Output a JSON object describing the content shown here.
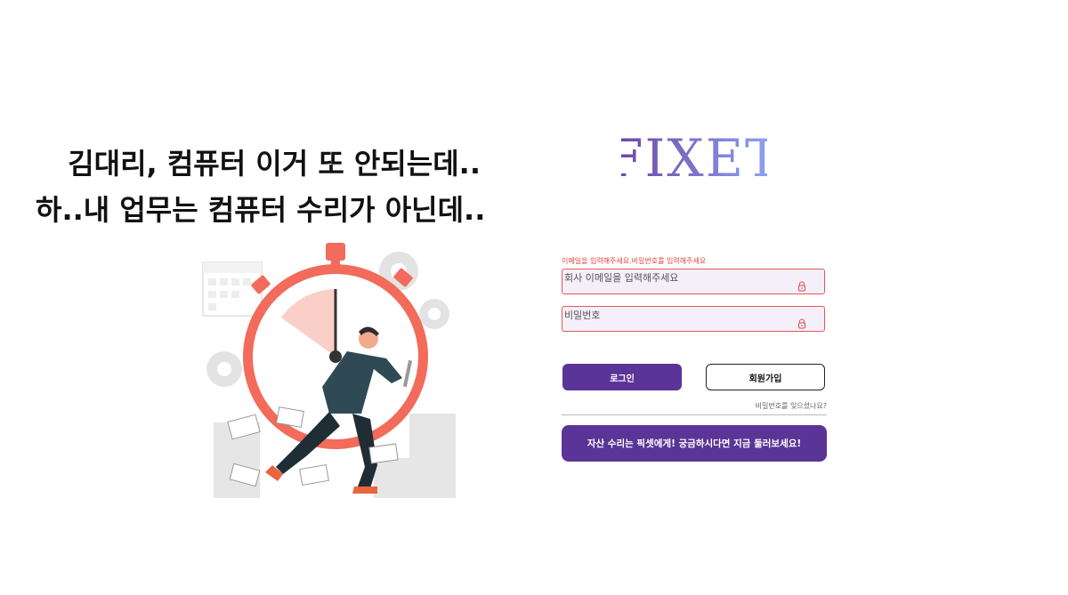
{
  "headline": {
    "line1": "김대리, 컴퓨터 이거 또 안되는데..",
    "line2": "하..내 업무는 컴퓨터 수리가 아닌데.."
  },
  "logo": {
    "text": "FIXET",
    "gradient_start": "#6b3fa0",
    "gradient_end": "#8fa8f5"
  },
  "login": {
    "error_message": "이메일을 입력해주세요.비밀번호를 입력해주세요",
    "email_placeholder": "회사 이메일을 입력해주세요",
    "password_placeholder": "비밀번호",
    "login_label": "로그인",
    "signup_label": "회원가입",
    "forgot_label": "비밀번호를 잊으셨나요?",
    "banner_label": "자산 수리는 픽셋에게! 궁금하시다면 지금 둘러보세요!"
  },
  "colors": {
    "accent": "#5b3497",
    "error": "#e0453f",
    "field_bg": "#f5eff9",
    "clock": "#f26b5b"
  }
}
